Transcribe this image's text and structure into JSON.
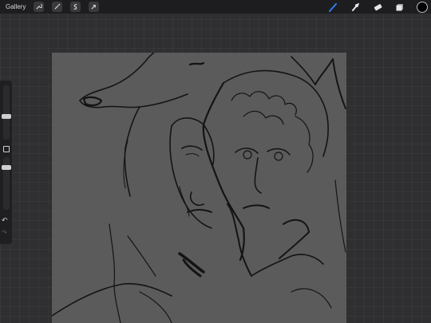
{
  "topbar": {
    "gallery_label": "Gallery",
    "left_tools": [
      "wrench-icon",
      "magic-wand-icon",
      "selection-icon",
      "transform-arrow-icon"
    ],
    "right_tools": [
      "brush-icon",
      "smudge-icon",
      "eraser-icon",
      "layers-icon",
      "color-swatch"
    ],
    "accent_color": "#2f7cf6",
    "current_color": "#000000"
  },
  "sidebar": {
    "brush_size_level": 0.45,
    "opacity_level": 0.8,
    "undo_icon": "undo-arrow-icon",
    "redo_icon": "redo-arrow-icon"
  },
  "canvas": {
    "background": "#5b5b5b",
    "content": "line-sketch"
  }
}
